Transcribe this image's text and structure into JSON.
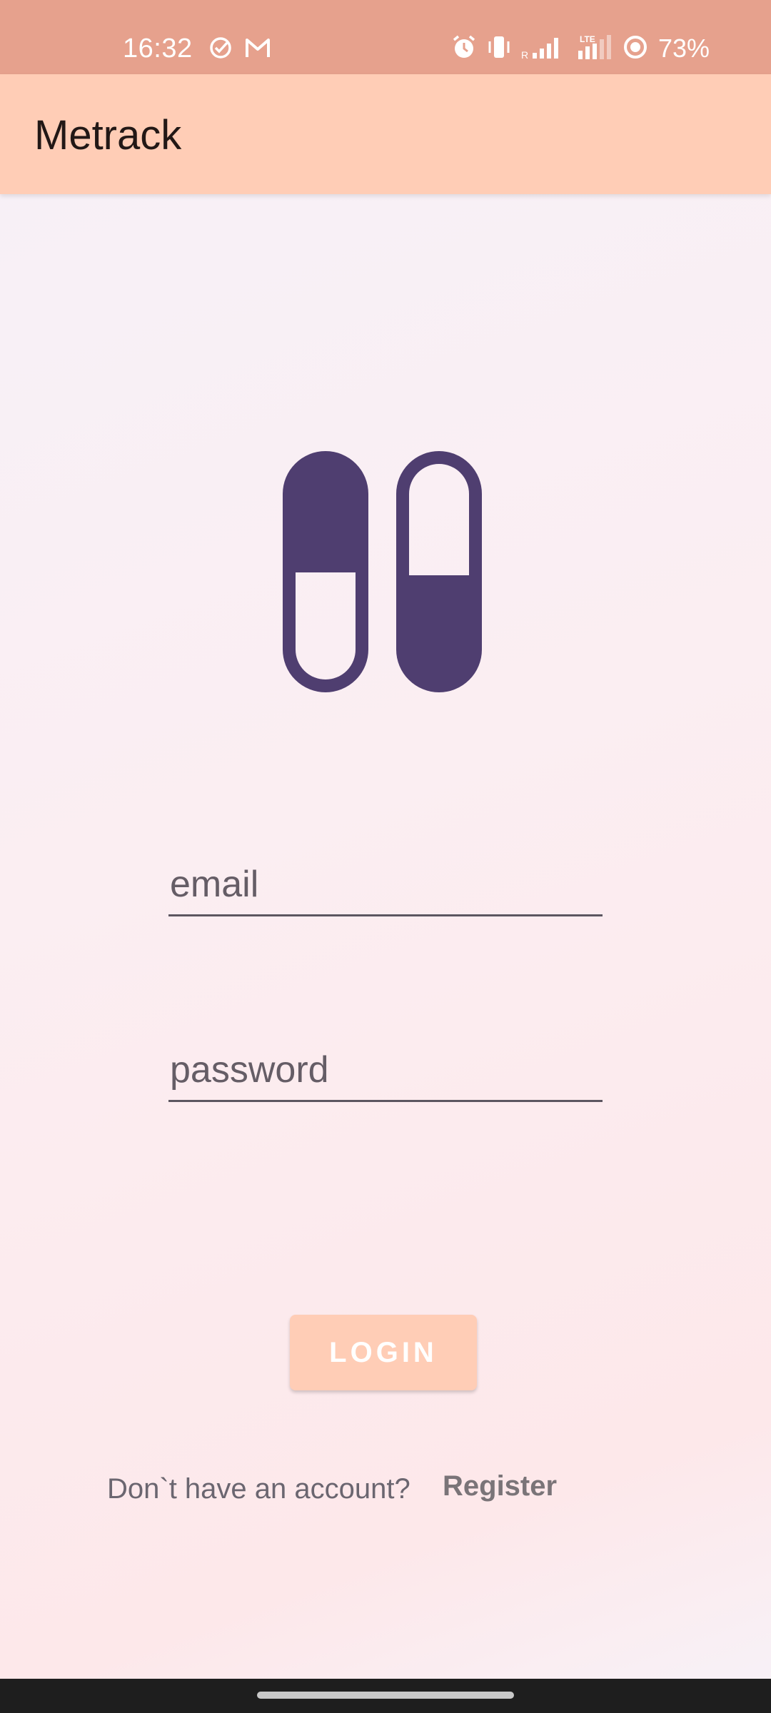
{
  "status_bar": {
    "time": "16:32",
    "battery": "73%",
    "left_icons": [
      "check-circle-icon",
      "gmail-icon"
    ],
    "right_icons": [
      "alarm-icon",
      "vibrate-icon",
      "signal-roaming-icon",
      "lte-signal-icon",
      "battery-saver-icon"
    ],
    "roaming_label": "R",
    "lte_label": "LTE"
  },
  "app_bar": {
    "title": "Metrack"
  },
  "logo": {
    "icon": "pills-icon",
    "color": "#4f3e70"
  },
  "form": {
    "email_placeholder": "email",
    "password_placeholder": "password",
    "login_label": "LOGIN"
  },
  "footer": {
    "prompt": "Don`t have an account?",
    "register_label": "Register"
  },
  "colors": {
    "status_bar": "#e6a18d",
    "app_bar": "#ffcdb6",
    "accent": "#4f3e70",
    "button": "#ffcdb6"
  }
}
